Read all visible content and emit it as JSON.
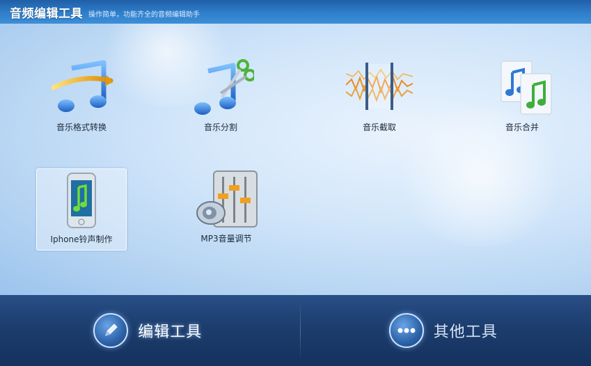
{
  "header": {
    "title": "音频编辑工具",
    "subtitle": "操作简单，功能齐全的音频编辑助手"
  },
  "tools": [
    {
      "label": "音乐格式转换",
      "icon": "music-convert-icon"
    },
    {
      "label": "音乐分割",
      "icon": "music-split-icon"
    },
    {
      "label": "音乐截取",
      "icon": "music-cut-icon"
    },
    {
      "label": "音乐合并",
      "icon": "music-merge-icon"
    },
    {
      "label": "Iphone铃声制作",
      "icon": "iphone-ringtone-icon",
      "selected": true
    },
    {
      "label": "MP3音量调节",
      "icon": "mp3-volume-icon"
    }
  ],
  "bottom_tabs": [
    {
      "label": "编辑工具",
      "icon": "pencil-icon",
      "active": true
    },
    {
      "label": "其他工具",
      "icon": "more-dots-icon",
      "active": false
    }
  ],
  "colors": {
    "header": "#2f7fcb",
    "bottom_bar": "#1c3d6e",
    "note_blue": "#2f78d6",
    "note_green": "#3fae3a",
    "wave_orange": "#f08a1c"
  }
}
